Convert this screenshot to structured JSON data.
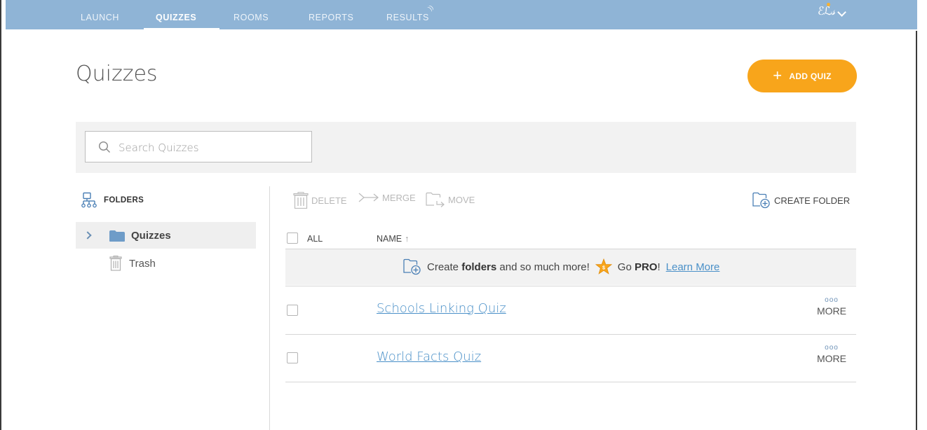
{
  "nav": {
    "items": [
      {
        "label": "LAUNCH"
      },
      {
        "label": "QUIZZES"
      },
      {
        "label": "ROOMS"
      },
      {
        "label": "REPORTS"
      },
      {
        "label": "RESULTS"
      }
    ],
    "active_index": 1,
    "logo_text": "ℰℒ𝓈"
  },
  "header": {
    "title": "Quizzes",
    "add_button_label": "ADD QUIZ",
    "add_button_icon": "+"
  },
  "search": {
    "placeholder": "Search Quizzes"
  },
  "sidebar": {
    "heading": "FOLDERS",
    "items": [
      {
        "label": "Quizzes",
        "icon": "folder-icon",
        "selected": true
      },
      {
        "label": "Trash",
        "icon": "trash-icon"
      }
    ]
  },
  "toolbar": {
    "delete_label": "DELETE",
    "merge_label": "MERGE",
    "move_label": "MOVE",
    "create_folder_label": "CREATE FOLDER"
  },
  "table": {
    "all_label": "ALL",
    "name_header": "NAME",
    "sort_arrow": "↑",
    "promo": {
      "prefix": "Create ",
      "bold": "folders",
      "middle": " and so much more!",
      "go_prefix": "Go ",
      "pro": "PRO",
      "go_suffix": "!",
      "link": "Learn More"
    },
    "rows": [
      {
        "name": "Schools Linking Quiz",
        "more_icon": "ooo",
        "more_label": "MORE"
      },
      {
        "name": "World Facts Quiz",
        "more_icon": "ooo",
        "more_label": "MORE"
      }
    ]
  },
  "colors": {
    "nav_bg": "#8fb4d6",
    "accent_orange": "#f8a51b",
    "link_blue": "#4a90c8"
  }
}
